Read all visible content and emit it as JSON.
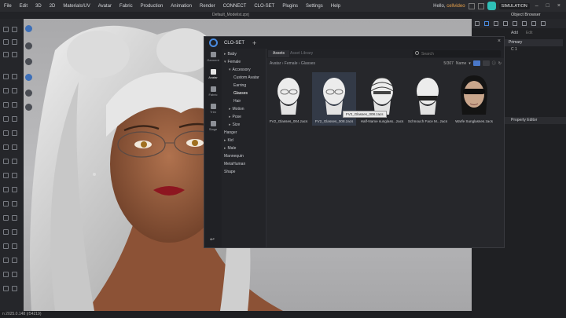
{
  "menu": [
    "File",
    "Edit",
    "3D",
    "2D",
    "Materials/UV",
    "Avatar",
    "Fabric",
    "Production",
    "Animation",
    "Render",
    "CONNECT",
    "CLO-SET",
    "Plugins",
    "Settings",
    "Help"
  ],
  "user": {
    "greeting": "Hello,",
    "name": "cellvideo"
  },
  "mode": "SIMULATION",
  "file_tab": "Default_Modelist.zprj",
  "status": "n 2025.0.148 (r54219)",
  "right_panel": {
    "title": "Object Browser",
    "add": "Add",
    "edit": "Edit",
    "primary": "Primary",
    "row": "C 1",
    "property": "Property Editor"
  },
  "clo": {
    "title": "CLO-SET",
    "nav": [
      {
        "label": "Garment"
      },
      {
        "label": "Avatar"
      },
      {
        "label": "Fabric"
      },
      {
        "label": "Trim"
      },
      {
        "label": "Stage"
      }
    ],
    "tree": [
      {
        "label": "Baby",
        "arrow": "▸"
      },
      {
        "label": "Female",
        "arrow": "▾"
      },
      {
        "label": "Accessory",
        "arrow": "▾"
      },
      {
        "label": "Custom Avatar",
        "arrow": ""
      },
      {
        "label": "Earring",
        "arrow": ""
      },
      {
        "label": "Glasses",
        "arrow": ""
      },
      {
        "label": "Hair",
        "arrow": ""
      },
      {
        "label": "Motion",
        "arrow": "▸"
      },
      {
        "label": "Pose",
        "arrow": "▸"
      },
      {
        "label": "Size",
        "arrow": "▸"
      },
      {
        "label": "Hanger",
        "arrow": ""
      },
      {
        "label": "Kid",
        "arrow": "▸"
      },
      {
        "label": "Male",
        "arrow": "▸"
      },
      {
        "label": "Mannequin",
        "arrow": ""
      },
      {
        "label": "MetaHuman",
        "arrow": ""
      },
      {
        "label": "Shape",
        "arrow": ""
      }
    ],
    "tabs": {
      "assets": "Assets",
      "other": "Asset Library"
    },
    "search_placeholder": "Search",
    "breadcrumb": "Avatar › Female › Glasses",
    "sort": {
      "count": "5/307",
      "label": "Name"
    },
    "items": [
      {
        "caption": "FV2_Glasses_004.zacs"
      },
      {
        "caption": "FV2_Glasses_008.zacs"
      },
      {
        "caption": "Half-Name sunglass...zacs"
      },
      {
        "caption": "Schnouch Face M...zacs"
      },
      {
        "caption": "Warfe Sunglasses.zacs"
      }
    ],
    "tooltip": "FV2_Glasses_008.zacs"
  },
  "colors": {
    "accent": "#4a8be0",
    "selected": "#333a47",
    "clo_badge": "#2fc0b8"
  }
}
